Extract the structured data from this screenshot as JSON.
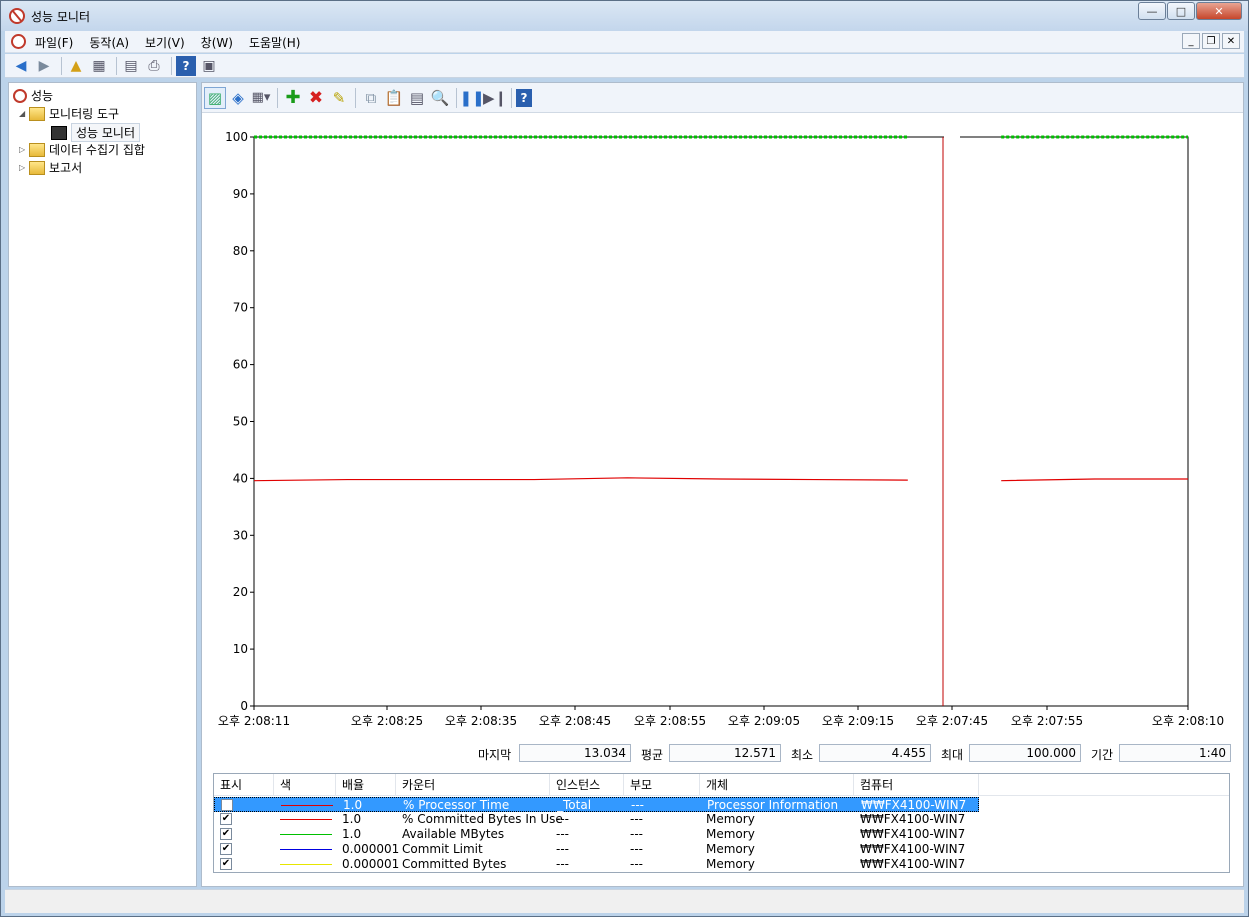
{
  "window": {
    "title": "성능 모니터",
    "buttons": {
      "minimize": "—",
      "maximize": "□",
      "close": "✕"
    }
  },
  "menu": {
    "items": [
      "파일(F)",
      "동작(A)",
      "보기(V)",
      "창(W)",
      "도움말(H)"
    ]
  },
  "tree": {
    "root": "성능",
    "monitoring_tools": "모니터링 도구",
    "performance_monitor": "성능 모니터",
    "data_collector_sets": "데이터 수집기 집합",
    "reports": "보고서"
  },
  "stats": {
    "last_label": "마지막",
    "last_value": "13.034",
    "average_label": "평균",
    "average_value": "12.571",
    "minimum_label": "최소",
    "minimum_value": "4.455",
    "maximum_label": "최대",
    "maximum_value": "100.000",
    "duration_label": "기간",
    "duration_value": "1:40"
  },
  "legend": {
    "headers": [
      "표시",
      "색",
      "배율",
      "카운터",
      "인스턴스",
      "부모",
      "개체",
      "컴퓨터"
    ],
    "rows": [
      {
        "checked": false,
        "color": "#e00000",
        "scale": "1.0",
        "counter": "% Processor Time",
        "instance": "_Total",
        "parent": "---",
        "object": "Processor Information",
        "computer": "₩₩FX4100-WIN7",
        "selected": true
      },
      {
        "checked": true,
        "color": "#e00000",
        "scale": "1.0",
        "counter": "% Committed Bytes In Use",
        "instance": "---",
        "parent": "---",
        "object": "Memory",
        "computer": "₩₩FX4100-WIN7",
        "selected": false
      },
      {
        "checked": true,
        "color": "#00c000",
        "scale": "1.0",
        "counter": "Available MBytes",
        "instance": "---",
        "parent": "---",
        "object": "Memory",
        "computer": "₩₩FX4100-WIN7",
        "selected": false
      },
      {
        "checked": true,
        "color": "#0000e0",
        "scale": "0.000001",
        "counter": "Commit Limit",
        "instance": "---",
        "parent": "---",
        "object": "Memory",
        "computer": "₩₩FX4100-WIN7",
        "selected": false
      },
      {
        "checked": true,
        "color": "#e6e600",
        "scale": "0.000001",
        "counter": "Committed Bytes",
        "instance": "---",
        "parent": "---",
        "object": "Memory",
        "computer": "₩₩FX4100-WIN7",
        "selected": false
      }
    ]
  },
  "chart_data": {
    "type": "line",
    "title": "",
    "xlabel": "",
    "ylabel": "",
    "ylim": [
      0,
      100
    ],
    "y_ticks": [
      0,
      10,
      20,
      30,
      40,
      50,
      60,
      70,
      80,
      90,
      100
    ],
    "x_tick_labels": [
      "오후 2:08:11",
      "오후 2:08:25",
      "오후 2:08:35",
      "오후 2:08:45",
      "오후 2:08:55",
      "오후 2:09:05",
      "오후 2:09:15",
      "오후 2:07:45",
      "오후 2:07:55",
      "오후 2:08:10"
    ],
    "series": [
      {
        "color": "#e00000",
        "values": [
          39.6,
          39.8,
          39.8,
          39.8,
          40.1,
          39.9,
          39.8,
          39.7,
          39.6,
          39.9,
          39.9
        ]
      },
      {
        "color": "#00c000",
        "values": [
          100,
          100,
          100,
          100,
          100,
          100,
          100,
          100,
          100,
          100,
          100
        ]
      }
    ],
    "grid": false
  }
}
